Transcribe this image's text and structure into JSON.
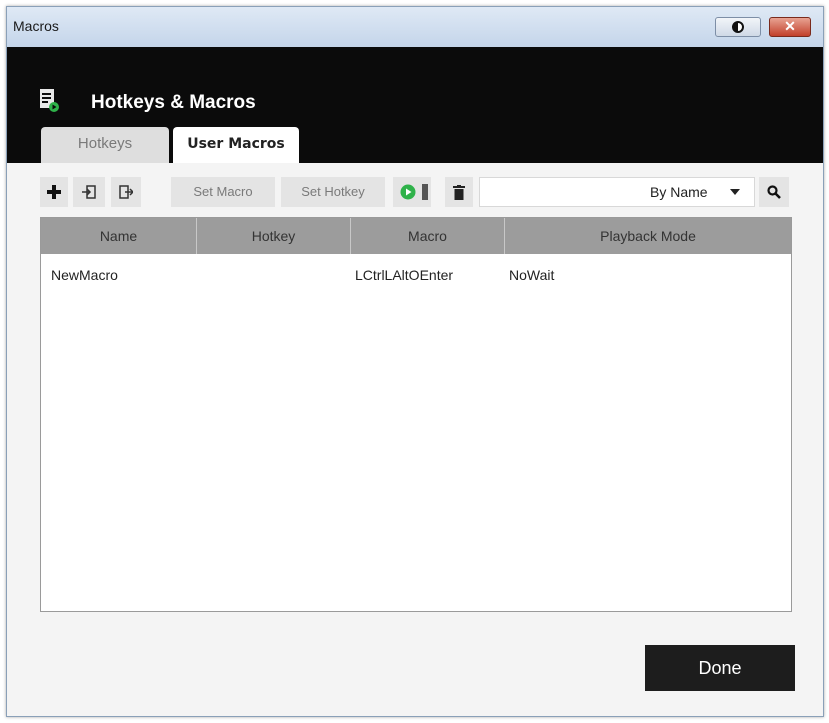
{
  "window": {
    "title": "Macros"
  },
  "header": {
    "title": "Hotkeys & Macros"
  },
  "tabs": [
    {
      "label": "Hotkeys",
      "active": false
    },
    {
      "label": "User Macros",
      "active": true
    }
  ],
  "toolbar": {
    "add_icon": "plus-icon",
    "import_icon": "import-icon",
    "export_icon": "export-icon",
    "set_macro_label": "Set Macro",
    "set_hotkey_label": "Set Hotkey",
    "play_icon": "play-icon",
    "delete_icon": "trash-icon",
    "search_value": "",
    "search_mode": "By Name",
    "search_icon": "magnifier-icon"
  },
  "table": {
    "columns": [
      "Name",
      "Hotkey",
      "Macro",
      "Playback Mode"
    ],
    "rows": [
      {
        "name": "NewMacro",
        "hotkey": "",
        "macro": "LCtrlLAltOEnter",
        "playback": "NoWait"
      }
    ]
  },
  "footer": {
    "done_label": "Done"
  },
  "colors": {
    "header_bg": "#0b0b0b",
    "play_green": "#2fb24a",
    "done_bg": "#1d1d1d"
  }
}
